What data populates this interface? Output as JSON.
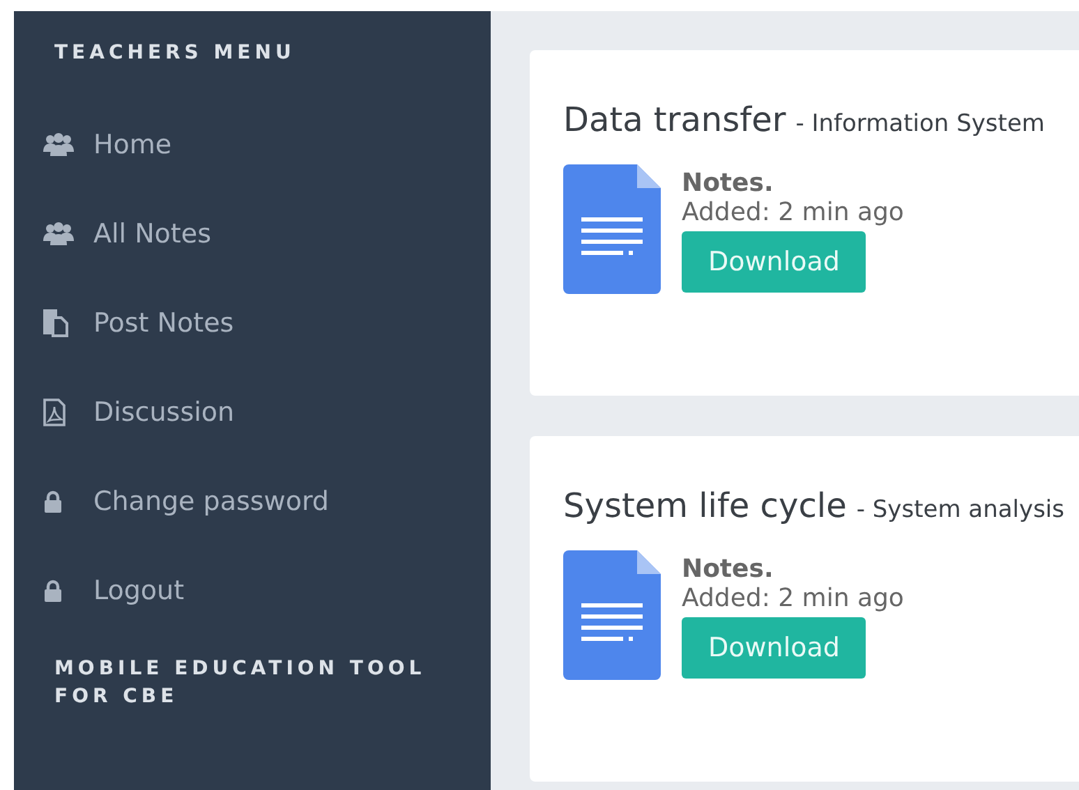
{
  "sidebar": {
    "heading": "TEACHERS MENU",
    "items": [
      {
        "label": "Home",
        "kind": "users"
      },
      {
        "label": "All Notes",
        "kind": "users"
      },
      {
        "label": "Post Notes",
        "kind": "copy"
      },
      {
        "label": "Discussion",
        "kind": "pdf"
      },
      {
        "label": "Change password",
        "kind": "lock"
      },
      {
        "label": "Logout",
        "kind": "lock"
      }
    ],
    "footer": "MOBILE EDUCATION TOOL FOR CBE"
  },
  "notes": [
    {
      "title": "Data transfer",
      "subject": "- Information System",
      "label": "Notes.",
      "added": "Added: 2 min ago",
      "button": "Download"
    },
    {
      "title": "System life cycle",
      "subject": "- System analysis",
      "label": "Notes.",
      "added": "Added: 2 min ago",
      "button": "Download"
    }
  ]
}
